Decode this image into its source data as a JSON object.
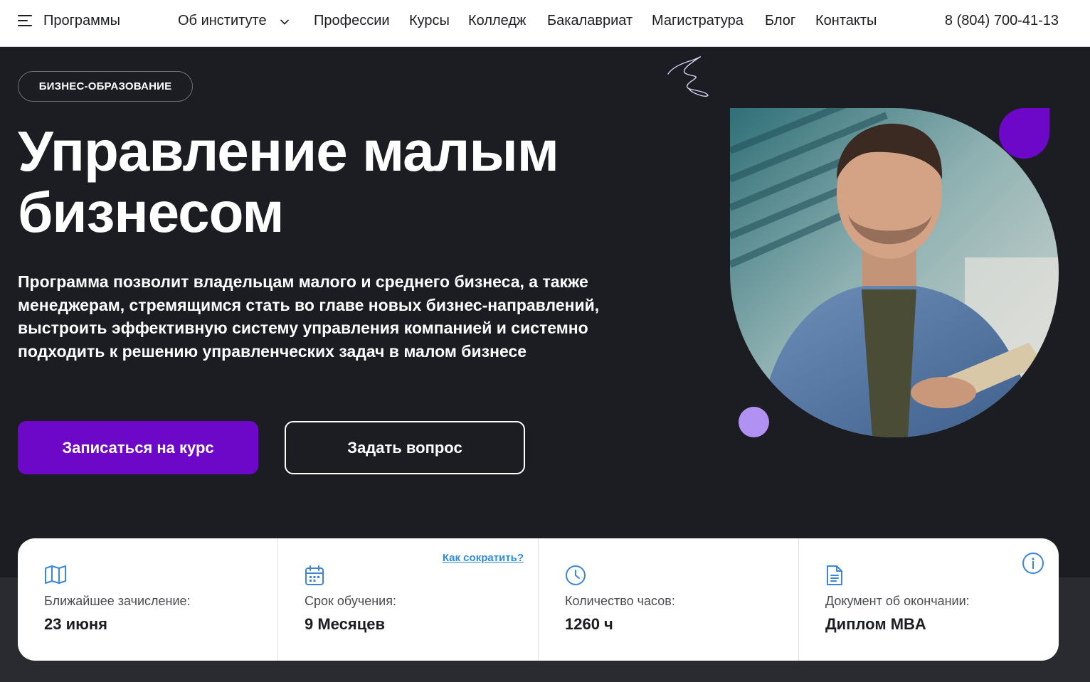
{
  "nav": {
    "programs": "Программы",
    "items": [
      "Об институте",
      "Профессии",
      "Курсы",
      "Колледж",
      "Бакалавриат",
      "Магистратура",
      "Блог",
      "Контакты"
    ],
    "phone": "8 (804) 700-41-13"
  },
  "hero": {
    "badge": "БИЗНЕС-ОБРАЗОВАНИЕ",
    "title_line1": "Управление малым",
    "title_line2": "бизнесом",
    "description": "Программа позволит владельцам малого и среднего бизнеса, а также менеджерам, стремящимся стать во главе новых бизнес-направлений, выстроить эффективную систему управления компанией и системно подходить к решению управленческих задач в малом бизнесе",
    "enroll_button": "Записаться на курс",
    "ask_button": "Задать вопрос"
  },
  "info": {
    "enrollment_label": "Ближайшее зачисление:",
    "enrollment_value": "23 июня",
    "duration_label": "Срок обучения:",
    "duration_value": "9 Месяцев",
    "shorten_link": "Как сократить?",
    "hours_label": "Количество часов:",
    "hours_value": "1260 ч",
    "document_label": "Документ об окончании:",
    "document_value": "Диплом MBA"
  },
  "icons": {
    "menu": "menu-icon",
    "chevron": "chevron-down-icon",
    "map": "map-icon",
    "calendar": "calendar-icon",
    "clock": "clock-icon",
    "document": "document-icon",
    "info": "info-icon"
  },
  "colors": {
    "accent": "#6d08c9",
    "lilac": "#b192f2",
    "background": "#1c1d22",
    "link": "#2d8de0",
    "icon_blue": "#3b86d8"
  }
}
